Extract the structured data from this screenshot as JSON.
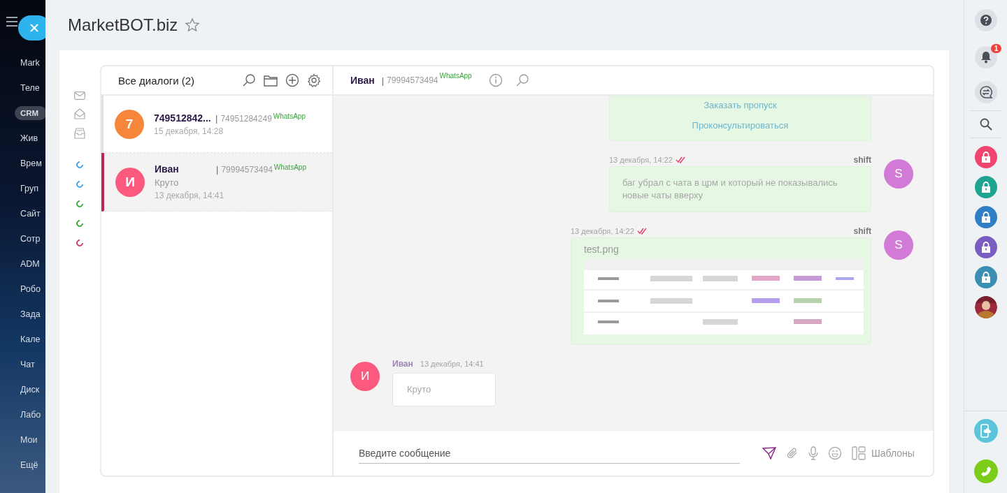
{
  "nav": {
    "items": [
      {
        "label": "Mark",
        "selected": false
      },
      {
        "label": "Теле",
        "selected": false
      },
      {
        "label": "CRM",
        "selected": true
      },
      {
        "label": "Жив",
        "selected": false
      },
      {
        "label": "Врем",
        "selected": false
      },
      {
        "label": "Груп",
        "selected": false
      },
      {
        "label": "Сайт",
        "selected": false
      },
      {
        "label": "Сотр",
        "selected": false
      },
      {
        "label": "ADM",
        "selected": false
      },
      {
        "label": "Робо",
        "selected": false
      },
      {
        "label": "Зада",
        "selected": false
      },
      {
        "label": "Кале",
        "selected": false
      },
      {
        "label": "Чат",
        "selected": false
      },
      {
        "label": "Диск",
        "selected": false
      },
      {
        "label": "Лабо",
        "selected": false
      },
      {
        "label": "Мои",
        "selected": false
      },
      {
        "label": "Ещё",
        "selected": false
      }
    ]
  },
  "page": {
    "title": "MarketBOT.biz",
    "favorite": false
  },
  "channel_dots": [
    {
      "color": "#3fa3e8"
    },
    {
      "color": "#3fa3e8"
    },
    {
      "color": "#3aab3a"
    },
    {
      "color": "#3aab3a"
    },
    {
      "color": "#c8386a"
    }
  ],
  "dialog_list": {
    "title": "Все диалоги (2)",
    "items": [
      {
        "avatar": "7",
        "color": "#f5863a",
        "name": "749512842...",
        "separator": "|",
        "phone": "74951284249",
        "channel": "WhatsApp",
        "date": "15 декабря, 14:28",
        "selected": false
      },
      {
        "avatar": "И",
        "color": "#fb5a7e",
        "name": "Иван",
        "separator": "|",
        "phone": "79994573494",
        "channel": "WhatsApp",
        "preview": "Круто",
        "date": "13 декабря, 14:41",
        "selected": true
      }
    ]
  },
  "chat": {
    "header": {
      "name": "Иван",
      "separator": "|",
      "phone": "79994573494",
      "channel": "WhatsApp"
    },
    "messages": [
      {
        "kind": "outgoing",
        "buttons": [
          "Заказать пропуск",
          "Проконсультироваться"
        ]
      },
      {
        "kind": "outgoing",
        "author": "shift",
        "avatar": "S",
        "color": "#d17ad6",
        "time": "13 декабря, 14:22",
        "read": true,
        "text": "баг убрал с чата в црм и который не показывались новые чаты вверху"
      },
      {
        "kind": "outgoing",
        "author": "shift",
        "avatar": "S",
        "color": "#d17ad6",
        "time": "13 декабря, 14:22",
        "read": true,
        "file": "test.png"
      },
      {
        "kind": "incoming",
        "author": "Иван",
        "avatar": "И",
        "color": "#fb5a7e",
        "time": "13 декабря, 14:41",
        "text": "Круто"
      }
    ],
    "composer": {
      "placeholder": "Введите сообщение",
      "templates_label": "Шаблоны"
    }
  },
  "rail": {
    "notifications_badge": "1",
    "locks": [
      {
        "color": "#f0456e"
      },
      {
        "color": "#1fa58f"
      },
      {
        "color": "#2f7fc6"
      },
      {
        "color": "#7a5dc0"
      },
      {
        "color": "#3a8fb2"
      }
    ]
  }
}
